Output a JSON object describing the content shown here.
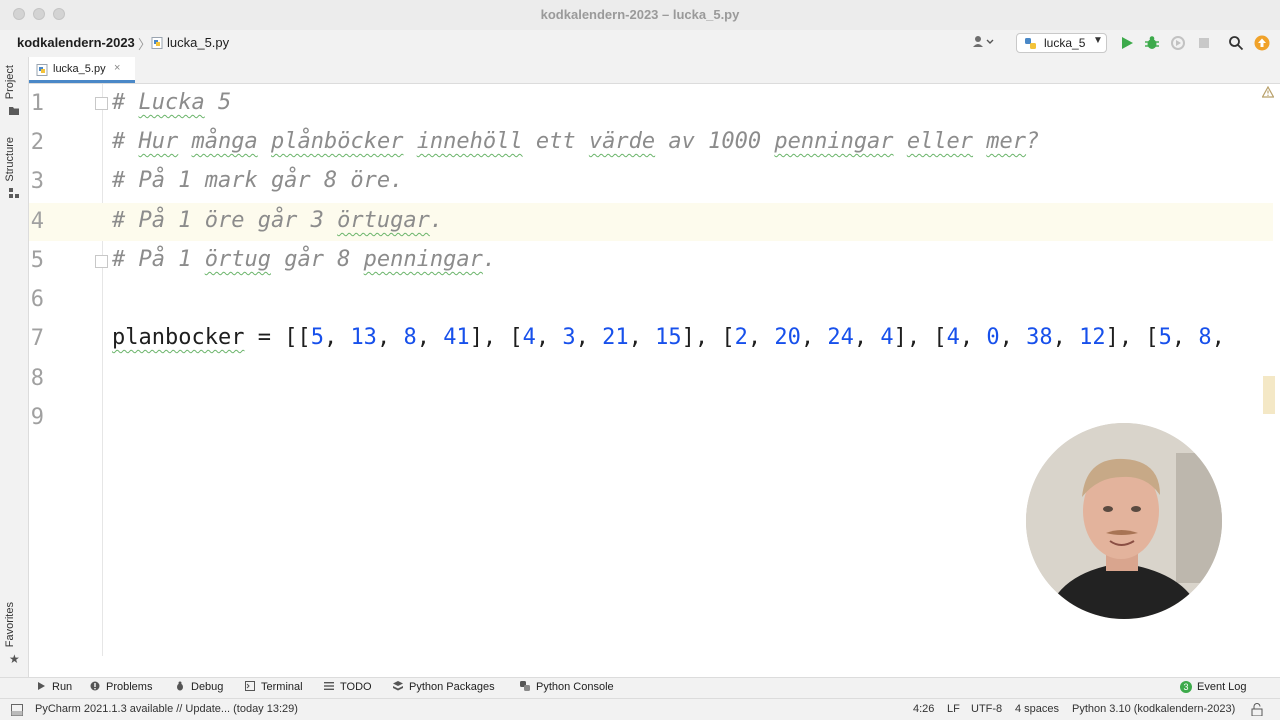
{
  "window": {
    "title": "kodkalendern-2023 – lucka_5.py"
  },
  "navbar": {
    "project": "kodkalendern-2023",
    "file": "lucka_5.py",
    "run_config": "lucka_5"
  },
  "tabs": [
    {
      "label": "lucka_5.py",
      "close": "×"
    }
  ],
  "left_strip": {
    "project_label": "Project",
    "structure_label": "Structure",
    "favorites_label": "Favorites"
  },
  "editor": {
    "lines": [
      {
        "n": "1"
      },
      {
        "n": "2"
      },
      {
        "n": "3"
      },
      {
        "n": "4"
      },
      {
        "n": "5"
      },
      {
        "n": "6"
      },
      {
        "n": "7"
      },
      {
        "n": "8"
      },
      {
        "n": "9"
      }
    ],
    "code": {
      "l1_hash": "# ",
      "l1_w1": "Lucka",
      "l1_rest": " 5",
      "l2_hash": "# ",
      "l2_w1": "Hur",
      "l2_sp1": " ",
      "l2_w2": "många",
      "l2_sp2": " ",
      "l2_w3": "plånböcker",
      "l2_sp3": " ",
      "l2_w4": "innehöll",
      "l2_sp4": " ett ",
      "l2_w5": "värde",
      "l2_sp5": " av 1000 ",
      "l2_w6": "penningar",
      "l2_sp6": " ",
      "l2_w7": "eller",
      "l2_sp7": " ",
      "l2_w8": "mer",
      "l2_end": "?",
      "l3": "# På 1 mark går 8 öre.",
      "l4_pre": "# På 1 öre går 3 ",
      "l4_w": "örtugar",
      "l4_end": ".",
      "l5_pre": "# På 1 ",
      "l5_w1": "örtug",
      "l5_mid": " går 8 ",
      "l5_w2": "penningar",
      "l5_end": ".",
      "l7_var": "planbocker",
      "l7_assign": " = [[",
      "l7_tokens": [
        "5",
        ", ",
        "13",
        ", ",
        "8",
        ", ",
        "41",
        "], [",
        "4",
        ", ",
        "3",
        ", ",
        "21",
        ", ",
        "15",
        "], [",
        "2",
        ", ",
        "20",
        ", ",
        "24",
        ", ",
        "4",
        "], [",
        "4",
        ", ",
        "0",
        ", ",
        "38",
        ", ",
        "12",
        "], [",
        "5",
        ", ",
        "8",
        ","
      ]
    }
  },
  "bottom_tools": {
    "run": "Run",
    "problems": "Problems",
    "debug": "Debug",
    "terminal": "Terminal",
    "todo": "TODO",
    "python_packages": "Python Packages",
    "python_console": "Python Console",
    "event_log": "Event Log",
    "event_count": "3"
  },
  "status": {
    "message": "PyCharm 2021.1.3 available // Update... (today 13:29)",
    "position": "4:26",
    "line_sep": "LF",
    "encoding": "UTF-8",
    "indent": "4 spaces",
    "interpreter": "Python 3.10 (kodkalendern-2023)"
  },
  "colors": {
    "accent": "#4a88c7",
    "number": "#1750eb",
    "comment": "#8c8c8c",
    "run": "#3daa4b",
    "update": "#f0a22a"
  }
}
